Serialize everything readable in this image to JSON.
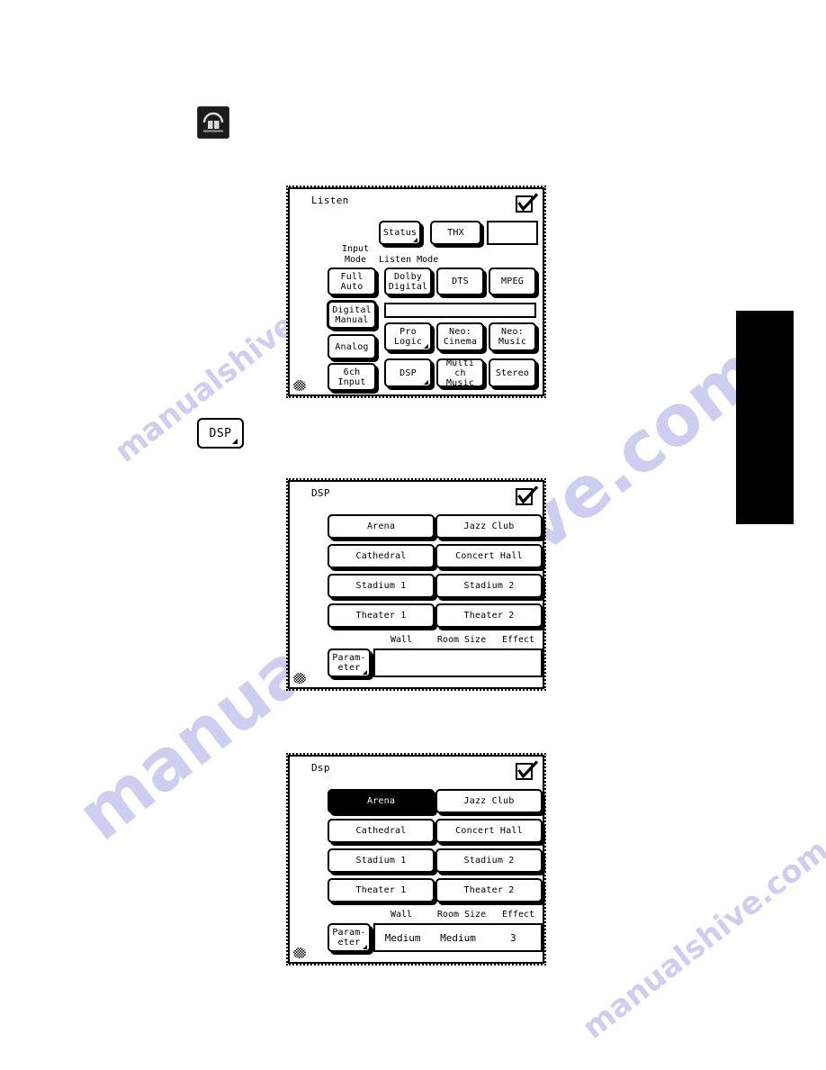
{
  "page": {
    "watermarks": [
      "ve.com",
      "manualshive",
      "manualshive.com",
      "manualshive.com"
    ]
  },
  "remote_keys": [
    {
      "name": "listen-mode-key",
      "icon": "dome-speaker-icon",
      "label": ""
    },
    {
      "name": "dsp-key",
      "icon": "dsp-key-icon",
      "label": "DSP"
    }
  ],
  "panels": [
    {
      "id": "listen",
      "title": "Listen",
      "checkbox_checked": true,
      "groups": {
        "input_mode_label": "Input\nMode",
        "input_mode_line1": "Input",
        "input_mode_line2": "Mode",
        "listen_mode_label": "Listen Mode"
      },
      "top_row": [
        {
          "label": "Status",
          "has_submenu": true,
          "style": "raised"
        },
        {
          "label": "THX",
          "has_submenu": false,
          "style": "raised"
        },
        {
          "label": "",
          "has_submenu": false,
          "style": "plain"
        }
      ],
      "input_mode_buttons": [
        {
          "line1": "Full",
          "line2": "Auto",
          "selected": false
        },
        {
          "line1": "Digital",
          "line2": "Manual",
          "selected": false,
          "emphasis": true
        },
        {
          "line1": "Analog",
          "line2": "",
          "selected": false
        },
        {
          "line1": "6ch",
          "line2": "Input",
          "selected": false
        }
      ],
      "listen_mode_buttons": [
        {
          "line1": "Dolby",
          "line2": "Digital",
          "has_submenu": false
        },
        {
          "line1": "DTS",
          "line2": "",
          "has_submenu": false
        },
        {
          "line1": "MPEG",
          "line2": "",
          "has_submenu": false
        },
        {
          "line1": "Pro",
          "line2": "Logic",
          "has_submenu": true
        },
        {
          "line1": "Neo:",
          "line2": "Cinema",
          "has_submenu": false
        },
        {
          "line1": "Neo:",
          "line2": "Music",
          "has_submenu": false
        },
        {
          "line1": "DSP",
          "line2": "",
          "has_submenu": true
        },
        {
          "line1": "Multi ch",
          "line2": "Music",
          "has_submenu": false
        },
        {
          "line1": "Stereo",
          "line2": "",
          "has_submenu": false
        }
      ],
      "status_field_value": ""
    },
    {
      "id": "dsp",
      "title": "DSP",
      "checkbox_checked": true,
      "modes": [
        {
          "label": "Arena",
          "selected": false
        },
        {
          "label": "Jazz Club",
          "selected": false
        },
        {
          "label": "Cathedral",
          "selected": false
        },
        {
          "label": "Concert Hall",
          "selected": false
        },
        {
          "label": "Stadium 1",
          "selected": false
        },
        {
          "label": "Stadium 2",
          "selected": false
        },
        {
          "label": "Theater 1",
          "selected": false
        },
        {
          "label": "Theater 2",
          "selected": false
        }
      ],
      "param_headers": [
        "Wall",
        "Room Size",
        "Effect"
      ],
      "param_button": {
        "line1": "Param-",
        "line2": "eter",
        "has_submenu": true
      },
      "param_values": [
        "",
        "",
        ""
      ]
    },
    {
      "id": "dsp2",
      "title": "Dsp",
      "checkbox_checked": true,
      "modes": [
        {
          "label": "Arena",
          "selected": true
        },
        {
          "label": "Jazz Club",
          "selected": false
        },
        {
          "label": "Cathedral",
          "selected": false
        },
        {
          "label": "Concert Hall",
          "selected": false
        },
        {
          "label": "Stadium 1",
          "selected": false
        },
        {
          "label": "Stadium 2",
          "selected": false
        },
        {
          "label": "Theater 1",
          "selected": false
        },
        {
          "label": "Theater 2",
          "selected": false
        }
      ],
      "param_headers": [
        "Wall",
        "Room Size",
        "Effect"
      ],
      "param_button": {
        "line1": "Param-",
        "line2": "eter",
        "has_submenu": true
      },
      "param_values": [
        "Medium",
        "Medium",
        "3"
      ]
    }
  ],
  "colors": {
    "ink": "#000000",
    "paper": "#ffffff",
    "watermark": "#ccccf0",
    "tab": "#000000"
  }
}
